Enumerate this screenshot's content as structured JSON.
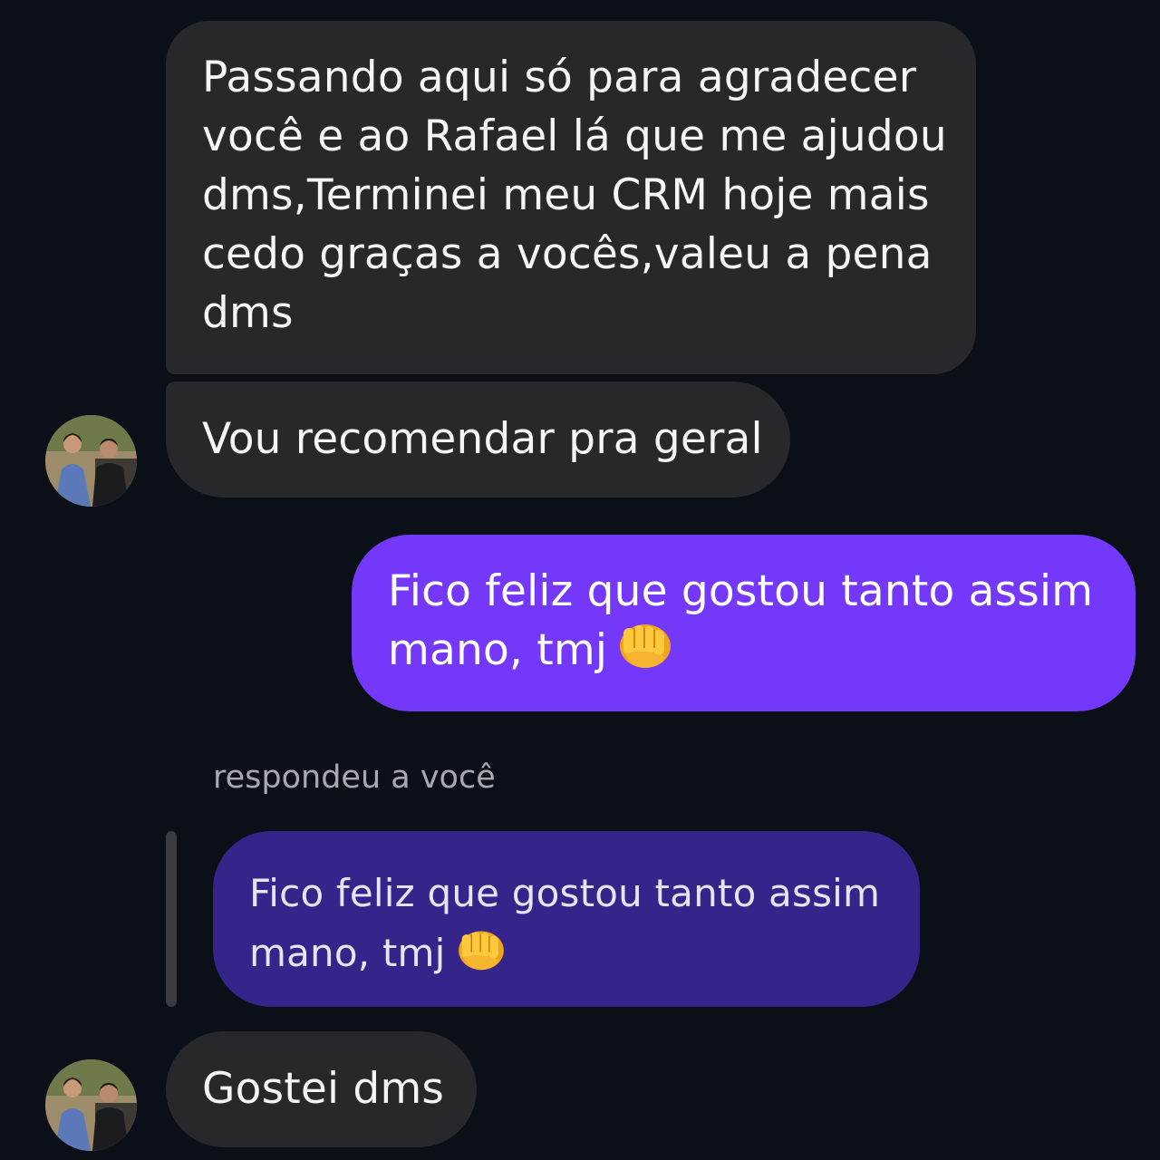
{
  "conversation": {
    "messages": [
      {
        "sender": "other",
        "lines": [
          "Passando aqui só para agradecer",
          "você e ao Rafael lá que me ajudou",
          "dms,Terminei meu CRM hoje mais",
          "cedo graças a vocês,valeu a pena",
          "dms"
        ]
      },
      {
        "sender": "other",
        "lines": [
          "Vou recomendar pra geral"
        ]
      },
      {
        "sender": "me",
        "lines": [
          "Fico feliz que gostou tanto assim",
          "mano, tmj"
        ],
        "emoji": "oncoming-fist-emoji"
      },
      {
        "sender": "other",
        "lines": [
          "Gostei dms"
        ]
      }
    ],
    "reply": {
      "caption": "respondeu a você",
      "quoted_lines": [
        "Fico feliz que gostou tanto assim",
        "mano, tmj"
      ],
      "quoted_emoji": "oncoming-fist-emoji"
    }
  },
  "colors": {
    "background": "#0b0f18",
    "incoming_bubble": "#26282c",
    "outgoing_bubble": "#7338f9",
    "quoted_bubble": "#35248a",
    "caption_text": "#a8aab0"
  },
  "icons": {
    "avatar": "contact-avatar-photo",
    "fist": "oncoming-fist-emoji"
  }
}
